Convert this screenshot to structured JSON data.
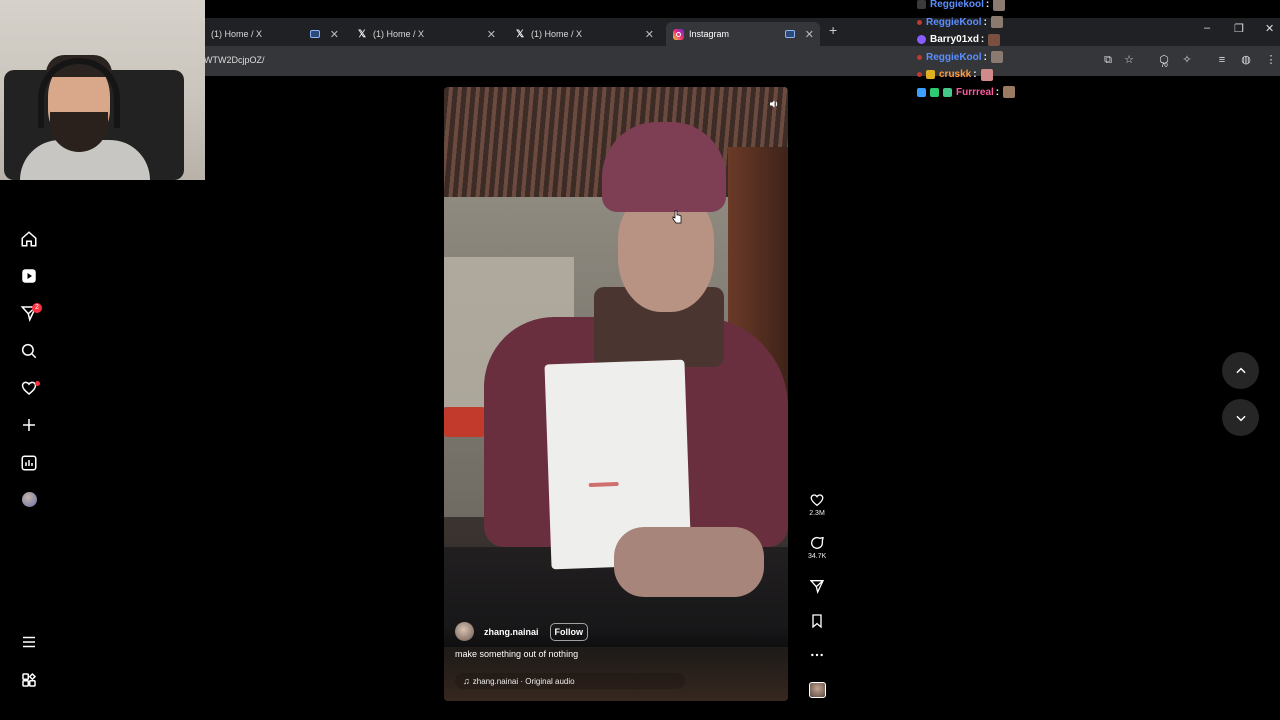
{
  "browser": {
    "tabs": [
      {
        "label": "(1) Home / X",
        "icon": "x-logo-icon"
      },
      {
        "label": "(1) Home / X",
        "icon": "x-logo-icon"
      },
      {
        "label": "(1) Home / X",
        "icon": "x-logo-icon"
      },
      {
        "label": "Instagram",
        "icon": "instagram-icon",
        "active": true
      }
    ],
    "url": "WTW2DcjpOZ/",
    "extension_badge": "70"
  },
  "chat": [
    {
      "user": "Reggiekool",
      "color": "#5a8fff"
    },
    {
      "user": "ReggieKool",
      "color": "#5a8fff"
    },
    {
      "user": "Barry01xd",
      "color": "#ffffff"
    },
    {
      "user": "ReggieKool",
      "color": "#5a8fff"
    },
    {
      "user": "cruskk",
      "color": "#ff9a3c"
    },
    {
      "user": "Furrreal",
      "color": "#ff5aa0"
    }
  ],
  "chat_separator": ":",
  "nav": {
    "messages_badge": "2",
    "items": [
      "home-icon",
      "reels-icon",
      "messages-icon",
      "search-icon",
      "notifications-icon",
      "create-icon",
      "dashboard-icon",
      "profile-avatar",
      "menu-icon",
      "more-apps-icon"
    ]
  },
  "reel": {
    "username": "zhang.nainai",
    "follow_label": "Follow",
    "caption": "make something out of nothing",
    "audio": "zhang.nainai · Original audio",
    "likes": "2.3M",
    "comments": "34.7K"
  },
  "colors": {
    "accent_red": "#ff3040",
    "page_bg": "#000000",
    "nav_button_bg": "#262626"
  }
}
